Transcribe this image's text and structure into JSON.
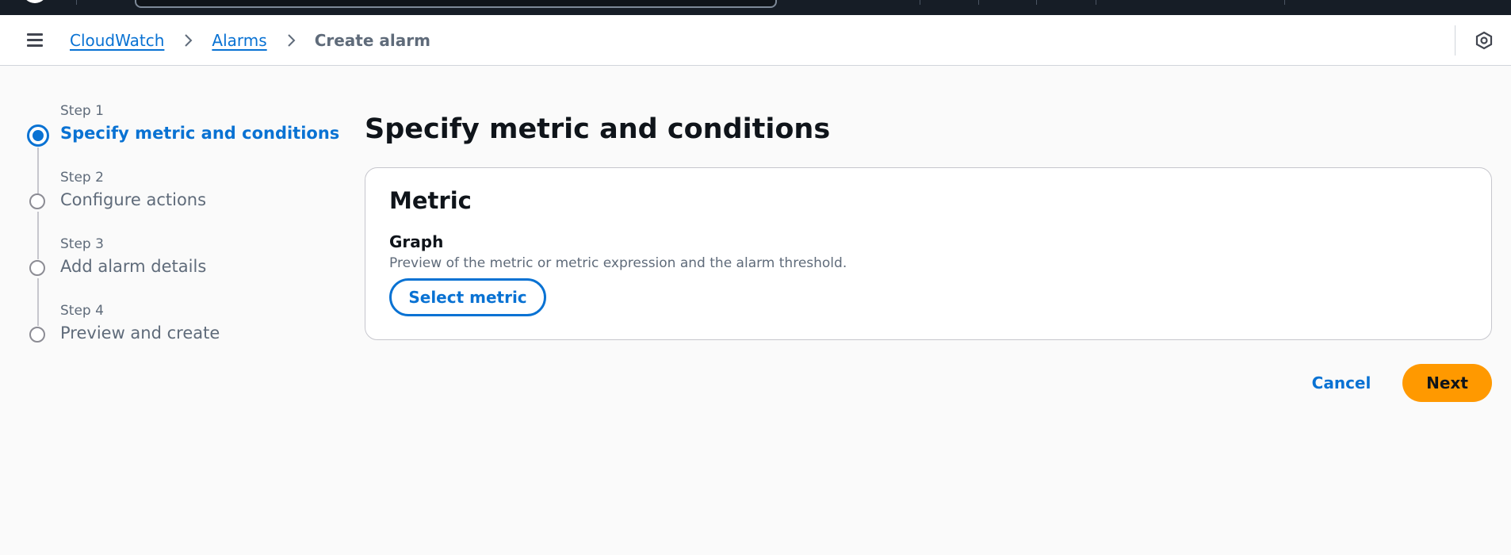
{
  "breadcrumb": {
    "items": [
      {
        "label": "CloudWatch"
      },
      {
        "label": "Alarms"
      }
    ],
    "current": "Create alarm"
  },
  "steps": [
    {
      "number": "Step 1",
      "title": "Specify metric and conditions",
      "active": true
    },
    {
      "number": "Step 2",
      "title": "Configure actions",
      "active": false
    },
    {
      "number": "Step 3",
      "title": "Add alarm details",
      "active": false
    },
    {
      "number": "Step 4",
      "title": "Preview and create",
      "active": false
    }
  ],
  "page": {
    "title": "Specify metric and conditions"
  },
  "metric_card": {
    "title": "Metric",
    "graph_label": "Graph",
    "graph_description": "Preview of the metric or metric expression and the alarm threshold.",
    "select_metric_label": "Select metric"
  },
  "actions": {
    "cancel_label": "Cancel",
    "next_label": "Next"
  },
  "colors": {
    "accent": "#0972d3",
    "primary_button": "#ff9900",
    "top_bar": "#161d26"
  },
  "icons": {
    "menu": "hamburger-menu-icon",
    "separator": "chevron-right-icon",
    "settings": "settings-hexagon-icon"
  }
}
